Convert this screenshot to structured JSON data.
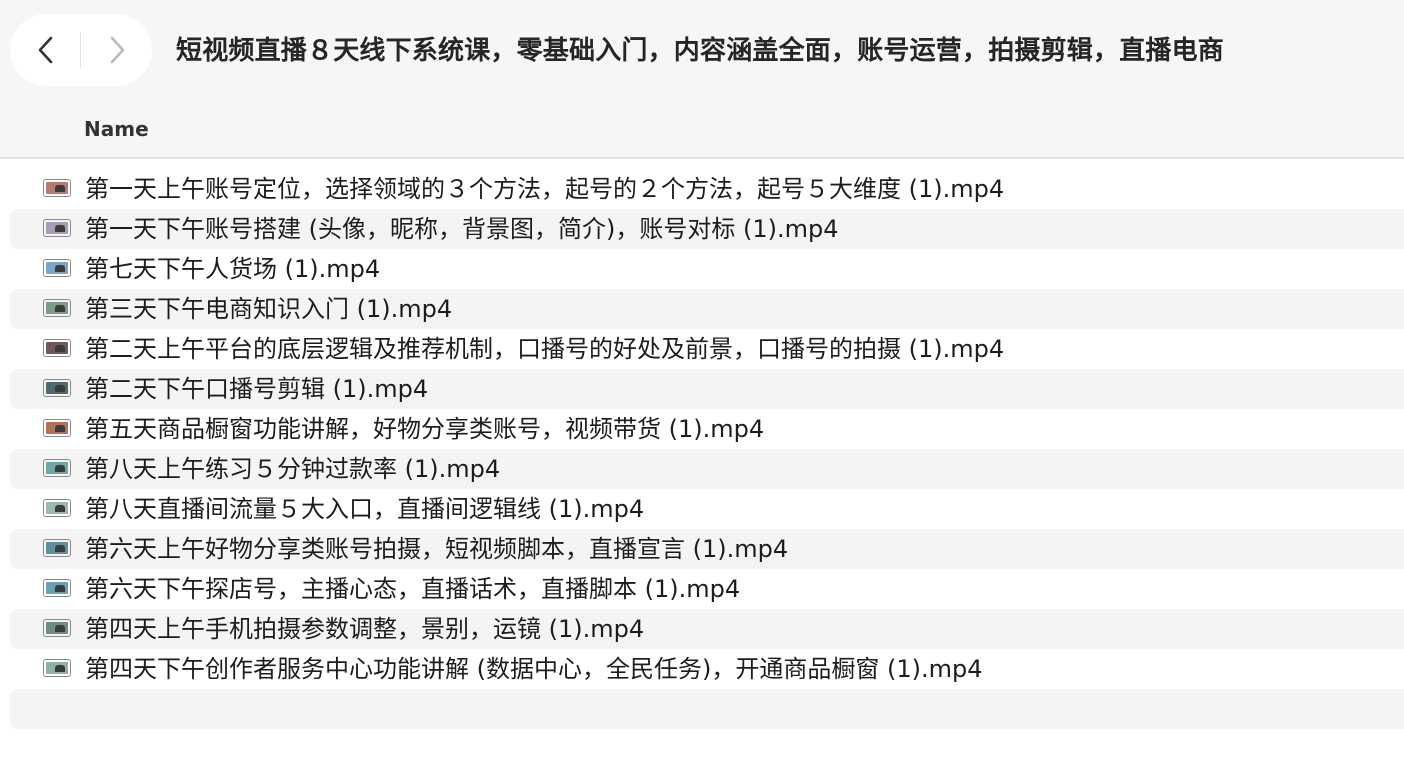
{
  "window": {
    "title": "短视频直播８天线下系统课，零基础入门，内容涵盖全面，账号运营，拍摄剪辑，直播电商"
  },
  "toolbar": {
    "back_icon": "chevron-left-icon",
    "forward_icon": "chevron-right-icon"
  },
  "columns": {
    "name": "Name"
  },
  "files": [
    {
      "name": "第一天上午账号定位，选择领域的３个方法，起号的２个方法，起号５大维度 (1).mp4",
      "icon": "video-thumbnail-icon",
      "tint": "#b77a72"
    },
    {
      "name": "第一天下午账号搭建 (头像，昵称，背景图，简介)，账号对标 (1).mp4",
      "icon": "video-thumbnail-icon",
      "tint": "#a79bb5"
    },
    {
      "name": "第七天下午人货场 (1).mp4",
      "icon": "video-thumbnail-icon",
      "tint": "#7ea6c4"
    },
    {
      "name": "第三天下午电商知识入门 (1).mp4",
      "icon": "video-thumbnail-icon",
      "tint": "#7c9a86"
    },
    {
      "name": "第二天上午平台的底层逻辑及推荐机制，口播号的好处及前景，口播号的拍摄 (1).mp4",
      "icon": "video-thumbnail-icon",
      "tint": "#6f5a5a"
    },
    {
      "name": "第二天下午口播号剪辑 (1).mp4",
      "icon": "video-thumbnail-icon",
      "tint": "#4f6a6e"
    },
    {
      "name": "第五天商品橱窗功能讲解，好物分享类账号，视频带货 (1).mp4",
      "icon": "video-thumbnail-icon",
      "tint": "#b0725a"
    },
    {
      "name": "第八天上午练习５分钟过款率 (1).mp4",
      "icon": "video-thumbnail-icon",
      "tint": "#6fa7a4"
    },
    {
      "name": "第八天直播间流量５大入口，直播间逻辑线 (1).mp4",
      "icon": "video-thumbnail-icon",
      "tint": "#9bb8b2"
    },
    {
      "name": "第六天上午好物分享类账号拍摄，短视频脚本，直播宣言 (1).mp4",
      "icon": "video-thumbnail-icon",
      "tint": "#5f8f9a"
    },
    {
      "name": "第六天下午探店号，主播心态，直播话术，直播脚本 (1).mp4",
      "icon": "video-thumbnail-icon",
      "tint": "#6d9fb4"
    },
    {
      "name": "第四天上午手机拍摄参数调整，景别，运镜 (1).mp4",
      "icon": "video-thumbnail-icon",
      "tint": "#6e8c84"
    },
    {
      "name": "第四天下午创作者服务中心功能讲解 (数据中心，全民任务)，开通商品橱窗 (1).mp4",
      "icon": "video-thumbnail-icon",
      "tint": "#8fb2a8"
    }
  ],
  "colors": {
    "toolbar_bg": "#f6f6f6",
    "row_alt_bg": "#f4f4f4",
    "text": "#1d1d1f"
  }
}
